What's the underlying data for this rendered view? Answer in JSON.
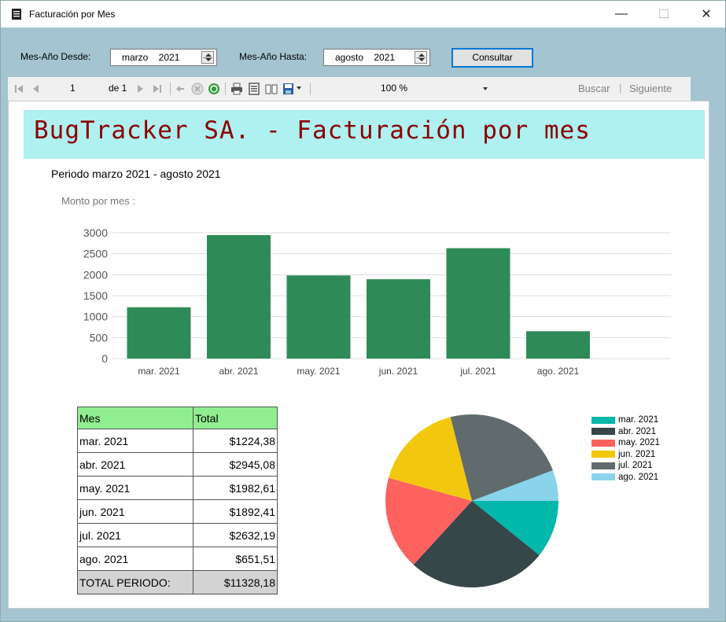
{
  "window": {
    "title": "Facturación por Mes",
    "icon": "document-icon",
    "min_glyph": "—",
    "max_glyph": "☐",
    "close_glyph": "✕"
  },
  "params": {
    "desde_label": "Mes-Año Desde:",
    "desde_value": "marzo    2021",
    "hasta_label": "Mes-Año Hasta:",
    "hasta_value": "agosto    2021",
    "consultar_label": "Consultar"
  },
  "toolbar": {
    "page_current": "1",
    "page_of": "de 1",
    "zoom": "100 %",
    "buscar": "Buscar",
    "separator": "|",
    "siguiente": "Siguiente"
  },
  "report": {
    "title": "BugTracker SA. - Facturación por mes",
    "periodo": "Periodo marzo 2021 - agosto 2021",
    "monto_label": "Monto por mes :",
    "title_bg": "#aff0f0",
    "title_color": "#8b0000"
  },
  "chart_data": [
    {
      "type": "bar",
      "categories": [
        "mar. 2021",
        "abr. 2021",
        "may. 2021",
        "jun. 2021",
        "jul. 2021",
        "ago. 2021"
      ],
      "values": [
        1224.38,
        2945.08,
        1982.61,
        1892.41,
        2632.19,
        651.51
      ],
      "ylim": [
        0,
        3000
      ],
      "yticks": [
        0,
        500,
        1000,
        1500,
        2000,
        2500,
        3000
      ],
      "color": "#2e8b57",
      "grid": true,
      "xlabel": "",
      "ylabel": "",
      "title": ""
    },
    {
      "type": "pie",
      "categories": [
        "mar. 2021",
        "abr. 2021",
        "may. 2021",
        "jun. 2021",
        "jul. 2021",
        "ago. 2021"
      ],
      "values": [
        1224.38,
        2945.08,
        1982.61,
        1892.41,
        2632.19,
        651.51
      ],
      "colors": [
        "#01b8aa",
        "#374649",
        "#fd625e",
        "#f2c80f",
        "#5f6b6d",
        "#8ad4eb"
      ],
      "legend": "right"
    }
  ],
  "table": {
    "headers": [
      "Mes",
      "Total"
    ],
    "rows": [
      [
        "mar. 2021",
        "$1224,38"
      ],
      [
        "abr. 2021",
        "$2945,08"
      ],
      [
        "may. 2021",
        "$1982,61"
      ],
      [
        "jun. 2021",
        "$1892,41"
      ],
      [
        "jul. 2021",
        "$2632,19"
      ],
      [
        "ago. 2021",
        "$651,51"
      ]
    ],
    "total_label": "TOTAL PERIODO:",
    "total_value": "$11328,18"
  }
}
